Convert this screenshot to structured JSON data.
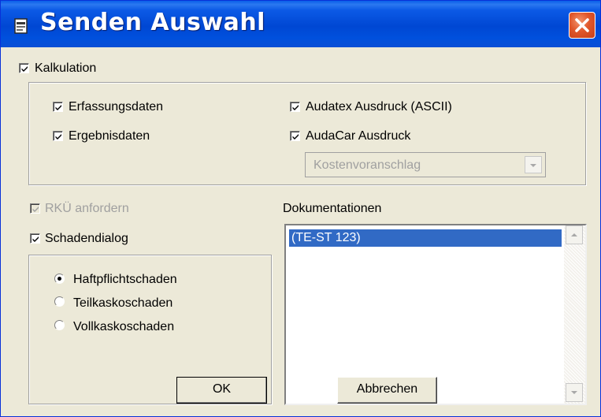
{
  "window": {
    "title": "Senden Auswahl",
    "icon": "document-icon"
  },
  "kalkulation": {
    "label": "Kalkulation",
    "checked": true,
    "erfassungsdaten": {
      "label": "Erfassungsdaten",
      "checked": true
    },
    "ergebnisdaten": {
      "label": "Ergebnisdaten",
      "checked": true
    },
    "audatex_ausdruck": {
      "label": "Audatex Ausdruck (ASCII)",
      "checked": true
    },
    "audacar_ausdruck": {
      "label": "AudaCar Ausdruck",
      "checked": true
    },
    "audacar_select": {
      "value": "Kostenvoranschlag",
      "disabled": true
    }
  },
  "rku": {
    "label": "RKÜ anfordern",
    "checked": true,
    "disabled": true
  },
  "schadendialog": {
    "label": "Schadendialog",
    "checked": true,
    "options": [
      {
        "label": "Haftpflichtschaden",
        "selected": true
      },
      {
        "label": "Teilkaskoschaden",
        "selected": false
      },
      {
        "label": "Vollkaskoschaden",
        "selected": false
      }
    ]
  },
  "dokumentationen": {
    "label": "Dokumentationen",
    "items": [
      "(TE-ST 123)"
    ]
  },
  "buttons": {
    "ok": "OK",
    "cancel": "Abbrechen"
  }
}
